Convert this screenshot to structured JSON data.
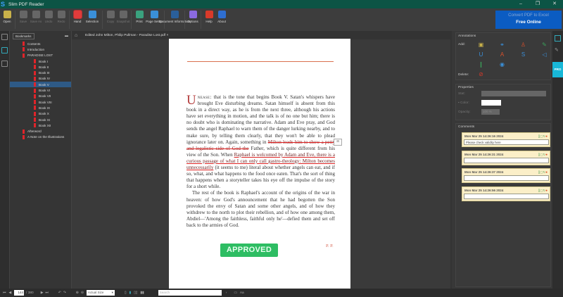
{
  "app": {
    "title": "Slim PDF Reader",
    "logo": "S"
  },
  "window_controls": [
    "–",
    "❐",
    "✕"
  ],
  "toolbar": [
    {
      "label": "Open",
      "icon": "folder-icon",
      "color": "#c9b24a",
      "enabled": true
    },
    {
      "label": "Save",
      "icon": "save-icon",
      "color": "#666",
      "enabled": false
    },
    {
      "label": "Save As",
      "icon": "save-as-icon",
      "color": "#666",
      "enabled": false
    },
    {
      "label": "Undo",
      "icon": "undo-icon",
      "color": "#666",
      "enabled": false
    },
    {
      "label": "Redo",
      "icon": "redo-icon",
      "color": "#666",
      "enabled": false
    },
    {
      "label": "Hand",
      "icon": "hand-icon",
      "color": "#e03b3b",
      "enabled": true,
      "active": true
    },
    {
      "label": "Selection",
      "icon": "selection-icon",
      "color": "#3a8fd8",
      "enabled": true
    },
    {
      "label": "Copy",
      "icon": "copy-icon",
      "color": "#666",
      "enabled": false
    },
    {
      "label": "Snapshot",
      "icon": "snapshot-icon",
      "color": "#666",
      "enabled": false
    },
    {
      "label": "Print",
      "icon": "print-icon",
      "color": "#3aa17e",
      "enabled": true
    },
    {
      "label": "Page Setup",
      "icon": "page-setup-icon",
      "color": "#3a8fd8",
      "enabled": true
    },
    {
      "label": "Document Information",
      "icon": "document-info-icon",
      "color": "#2a5f9a",
      "enabled": true
    },
    {
      "label": "Options",
      "icon": "gear-icon",
      "color": "#8a6ae0",
      "enabled": true
    },
    {
      "label": "Help",
      "icon": "help-icon",
      "color": "#d83a2a",
      "enabled": true
    },
    {
      "label": "About",
      "icon": "info-icon",
      "color": "#2e6ed0",
      "enabled": true
    }
  ],
  "promo": {
    "line1": "Convert PDF to Excel",
    "line2": "Free Online"
  },
  "bookmarks": {
    "selector": "Bookmarks",
    "items": [
      {
        "label": "Contents",
        "level": 0
      },
      {
        "label": "Introduction",
        "level": 0
      },
      {
        "label": "PARADISE LOST",
        "level": 0,
        "expanded": true
      },
      {
        "label": "Book I",
        "level": 1
      },
      {
        "label": "Book II",
        "level": 1
      },
      {
        "label": "Book III",
        "level": 1
      },
      {
        "label": "Book IV",
        "level": 1
      },
      {
        "label": "Book V",
        "level": 1,
        "selected": true
      },
      {
        "label": "Book VI",
        "level": 1
      },
      {
        "label": "Book VII",
        "level": 1
      },
      {
        "label": "Book VIII",
        "level": 1
      },
      {
        "label": "Book IX",
        "level": 1
      },
      {
        "label": "Book X",
        "level": 1
      },
      {
        "label": "Book XI",
        "level": 1
      },
      {
        "label": "Book XII",
        "level": 1
      },
      {
        "label": "Afterword",
        "level": 0
      },
      {
        "label": "A Note on the Illustrations",
        "level": 0
      }
    ]
  },
  "tab": {
    "title": "Edited John Milton, Philip Pullman - Paradise Lost.pdf",
    "close": "×"
  },
  "page": {
    "drop_cap": "U",
    "small_caps": "nease:",
    "p1_a": " that is the tone that begins Book V. Satan's whispers have brought Eve disturbing dreams. Satan himself is absent from this book in a direct way, as he is from the next three, although his actions have set everything in motion, and the talk is of no one but him; there is no doubt who is dominating the narrative. Adam and Eve pray, and God sends the angel Raphael to warn them of the danger lurking nearby, and to make sure, by telling them clearly, that they won't be able to plead ignorance later on. Again, something in ",
    "p1_strike": "Milton leads him to show a petty and legalistic side of God the",
    "p1_b": " Father, which is quite different from his view of the Son. When ",
    "p1_under": "Raphael is welcomed by Adam and Eve, there is a curious passage of what I can only call gastro-theology: Milton becomes unnecessarily",
    "p1_c": " (it seems to me) literal about whether angels can eat, and if so, what, and what happens to the food once eaten. That's the sort of thing that happens when a storyteller takes his eye off the impulse of the story for a short while.",
    "p2": "The rest of the book is Raphael's account of the origins of the war in heaven: of how God's announcement that he had begotten the Son provoked the envy of Satan and some other angels, and of how they withdrew to the north to plot their rebellion, and of how one among them, Abdiel—'Among the faithless, faithful only he'—defied them and set off back to the armies of God.",
    "stamp": "APPROVED",
    "initials": "P. P.",
    "note_icon": "≡"
  },
  "annotations": {
    "title": "Annotations",
    "add": "Add:",
    "delete": "Delete:"
  },
  "properties": {
    "title": "Properties",
    "state": "Stat:",
    "color": "Color:",
    "opacity": "Opacity:",
    "opacity_value": "100 %"
  },
  "comments": {
    "title": "Comments",
    "items": [
      {
        "date": "Mon Mar 25 14:26:16 2024",
        "text": "Please check validity here"
      },
      {
        "date": "Mon Mar 25 14:26:31 2024",
        "text": ""
      },
      {
        "date": "Mon Mar 25 14:26:37 2024",
        "text": ""
      },
      {
        "date": "Mon Mar 25 14:26:56 2024",
        "text": ""
      }
    ]
  },
  "right_strip": {
    "pro": "PRO"
  },
  "status": {
    "page": "144",
    "total": "/ 380",
    "zoom": "Actual Size",
    "search_placeholder": "Search",
    "aa": "Aa"
  }
}
